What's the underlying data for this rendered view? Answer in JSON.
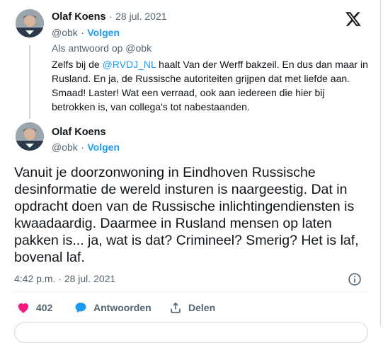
{
  "reply_tweet": {
    "author_name": "Olaf Koens",
    "date": "28 jul. 2021",
    "handle": "@obk",
    "follow_label": "Volgen",
    "reply_prefix": "Als antwoord op",
    "reply_to": "@obk",
    "text_before_mention": "Zelfs bij de ",
    "mention": "@RVDJ_NL",
    "text_after_mention": " haalt Van der Werff bakzeil. En dus dan maar in Rusland. En ja, de Russische autoriteiten grijpen dat met liefde aan. Smaad! Laster! Wat een verraad, ook aan iedereen die hier bij betrokken is, van collega's tot nabestaanden."
  },
  "main_tweet": {
    "author_name": "Olaf Koens",
    "handle": "@obk",
    "follow_label": "Volgen",
    "text": "Vanuit je doorzonwoning in Eindhoven Russische desinformatie de wereld insturen is naargeestig. Dat in opdracht doen van de Russische inlichtingendiensten is kwaadaardig. Daarmee in Rusland mensen op laten pakken is... ja, wat is dat? Crimineel? Smerig? Het is laf, bovenal laf.",
    "time": "4:42 p.m.",
    "date": "28 jul. 2021"
  },
  "separator": "·",
  "actions": {
    "likes_count": "402",
    "reply_label": "Antwoorden",
    "share_label": "Delen"
  },
  "icons": [
    "x-logo-icon",
    "heart-icon",
    "reply-bubble-icon",
    "share-icon",
    "info-icon"
  ],
  "colors": {
    "accent": "#1d9bf0",
    "like": "#f91880",
    "muted": "#536471",
    "text": "#0f1419"
  }
}
